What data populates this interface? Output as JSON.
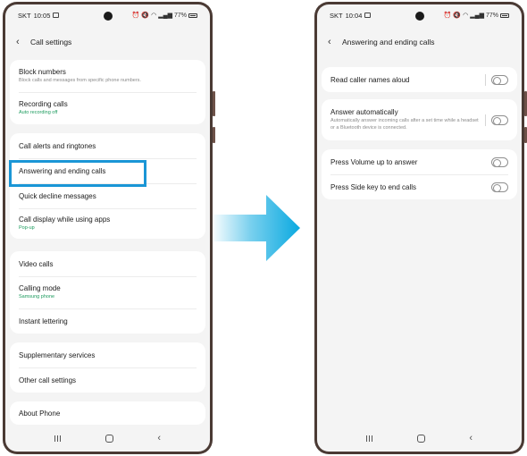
{
  "left_phone": {
    "status": {
      "carrier": "SKT",
      "time": "10:05",
      "battery": "77%"
    },
    "header": {
      "title": "Call settings"
    },
    "groups": [
      [
        {
          "title": "Block numbers",
          "sub": "Block calls and messages from specific phone numbers.",
          "accent": false
        },
        {
          "title": "Recording calls",
          "sub": "Auto recording off",
          "accent": true
        }
      ],
      [
        {
          "title": "Call alerts and ringtones",
          "sub": "",
          "accent": false
        },
        {
          "title": "Answering and ending calls",
          "sub": "",
          "accent": false
        },
        {
          "title": "Quick decline messages",
          "sub": "",
          "accent": false
        },
        {
          "title": "Call display while using apps",
          "sub": "Pop-up",
          "accent": true
        }
      ],
      [
        {
          "title": "Video calls",
          "sub": "",
          "accent": false
        },
        {
          "title": "Calling mode",
          "sub": "Samsung phone",
          "accent": true
        },
        {
          "title": "Instant lettering",
          "sub": "",
          "accent": false
        }
      ],
      [
        {
          "title": "Supplementary services",
          "sub": "",
          "accent": false
        },
        {
          "title": "Other call settings",
          "sub": "",
          "accent": false
        }
      ],
      [
        {
          "title": "About Phone",
          "sub": "",
          "accent": false
        }
      ]
    ]
  },
  "right_phone": {
    "status": {
      "carrier": "SKT",
      "time": "10:04",
      "battery": "77%"
    },
    "header": {
      "title": "Answering and ending calls"
    },
    "groups": [
      [
        {
          "title": "Read caller names aloud",
          "sub": "",
          "toggle": false
        }
      ],
      [
        {
          "title": "Answer automatically",
          "sub": "Automatically answer incoming calls after a set time while a headset or a Bluetooth device is connected.",
          "toggle": false
        }
      ],
      [
        {
          "title": "Press Volume up to answer",
          "sub": "",
          "toggle": false
        },
        {
          "title": "Press Side key to end calls",
          "sub": "",
          "toggle": false
        }
      ]
    ]
  },
  "colors": {
    "highlight": "#1a96d6",
    "accent_text": "#1d9b5e",
    "arrow": "#0aa9e0"
  }
}
